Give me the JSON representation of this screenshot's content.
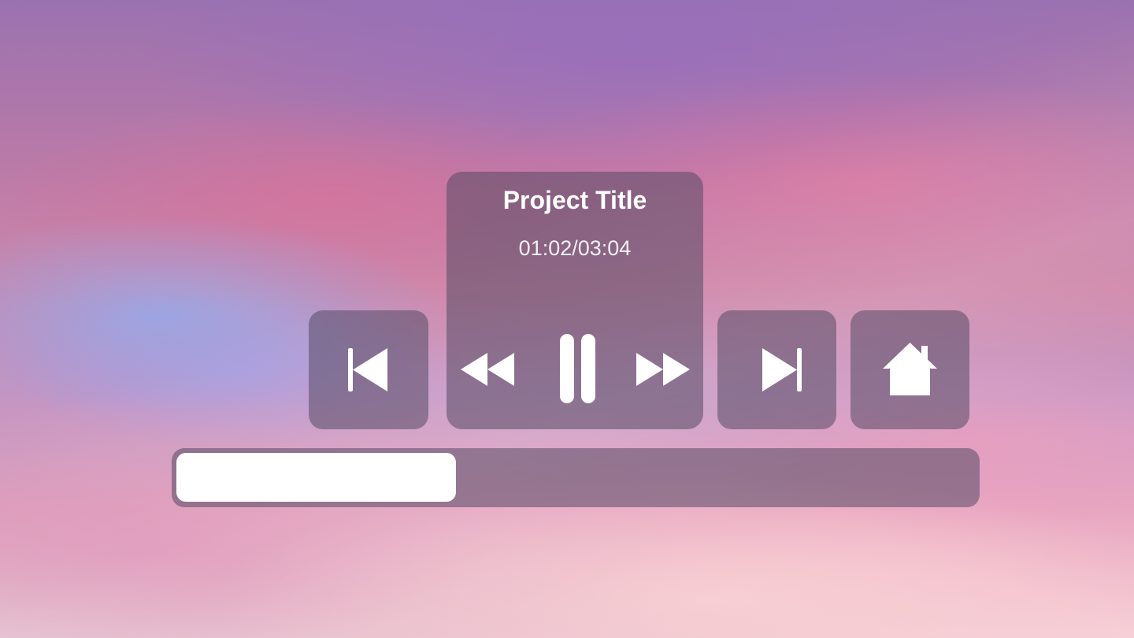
{
  "player": {
    "title": "Project Title",
    "time": "01:02/03:04",
    "progress_fraction": 0.35
  },
  "controls": {
    "previous": "skip-back-icon",
    "rewind": "rewind-icon",
    "play_pause": "pause-icon",
    "fast_forward": "fast-forward-icon",
    "next": "skip-forward-icon",
    "home": "home-icon"
  },
  "colors": {
    "panel": "#554b64",
    "icon": "#ffffff",
    "progress_fill": "#ffffff"
  }
}
